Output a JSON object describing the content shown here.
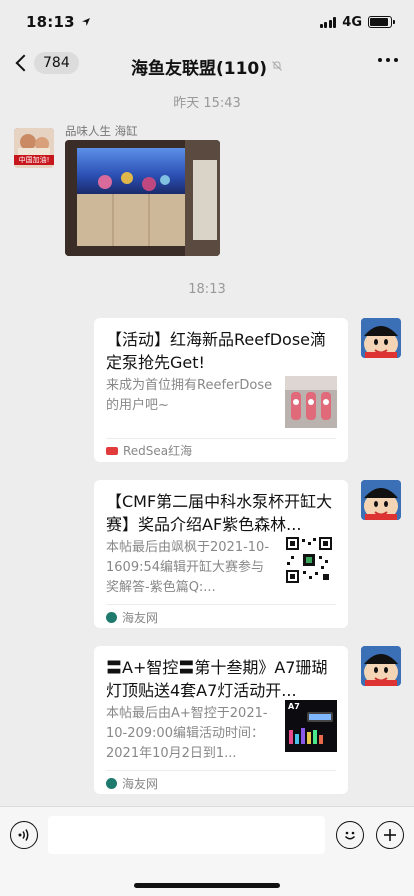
{
  "status_bar": {
    "time": "18:13",
    "network": "4G",
    "location_icon": "location-arrow-icon",
    "battery_level": 0.9
  },
  "nav": {
    "unread_count": "784",
    "title": "海鱼友联盟(110)",
    "mute_icon": "bell-off-icon",
    "more_icon": "more-icon"
  },
  "messages": {
    "timestamp_1": "昨天 15:43",
    "first_sender": "品味人生 海缸",
    "avatar_flag_text": "中国加油!",
    "timestamp_2": "18:13",
    "cards": [
      {
        "title": "【活动】红海新品ReefDose滴定泵抢先Get!",
        "desc": "来成为首位拥有ReeferDose的用户吧~",
        "source": "RedSea红海"
      },
      {
        "title": "【CMF第二届中科水泵杯开缸大赛】奖品介绍AF紫色森林...",
        "desc": "本帖最后由飒枫于2021-10-1609:54编辑开缸大赛参与奖解答-紫色篇Q:...",
        "source": "海友网"
      },
      {
        "title": "〓A+智控〓第十叁期》A7珊瑚灯顶贴送4套A7灯活动开...",
        "desc": "本帖最后由A+智控于2021-10-209:00编辑活动时间：2021年10月2日到1...",
        "source": "海友网",
        "thumb_label": "A7"
      }
    ]
  },
  "input_bar": {
    "voice_icon": "voice-icon",
    "emoji_icon": "emoji-icon",
    "plus_icon": "plus-icon",
    "placeholder": ""
  }
}
